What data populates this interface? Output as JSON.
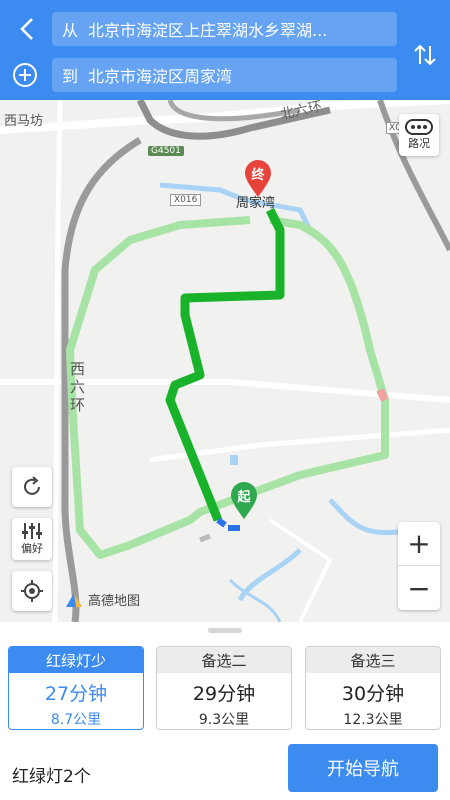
{
  "header": {
    "from_prefix": "从",
    "from_value": "北京市海淀区上庄翠湖水乡翠湖...",
    "to_prefix": "到",
    "to_value": "北京市海淀区周家湾"
  },
  "map": {
    "labels": {
      "place_ximafang": "西马坊",
      "road_g4501": "G4501",
      "road_x016": "X016",
      "road_x0": "X0",
      "road_north6": "北六环",
      "road_west6": "西六环",
      "dest_name": "周家湾"
    },
    "markers": {
      "end_label": "终",
      "start_label": "起"
    },
    "controls": {
      "traffic_label": "路况",
      "pref_label": "偏好",
      "zoom_in": "+",
      "zoom_out": "−"
    },
    "logo_text": "高德地图",
    "colors": {
      "route_selected": "#19b32b",
      "route_alt": "#a8e3a6",
      "road_major": "#8e8e8e",
      "river": "#a9d3f5"
    }
  },
  "routes": [
    {
      "tag": "红绿灯少",
      "time": "27分钟",
      "distance": "8.7公里",
      "selected": true
    },
    {
      "tag": "备选二",
      "time": "29分钟",
      "distance": "9.3公里",
      "selected": false
    },
    {
      "tag": "备选三",
      "time": "30分钟",
      "distance": "12.3公里",
      "selected": false
    }
  ],
  "footer": {
    "lights_info": "红绿灯2个",
    "start_label": "开始导航"
  },
  "theme": {
    "primary": "#3b8bf0"
  }
}
